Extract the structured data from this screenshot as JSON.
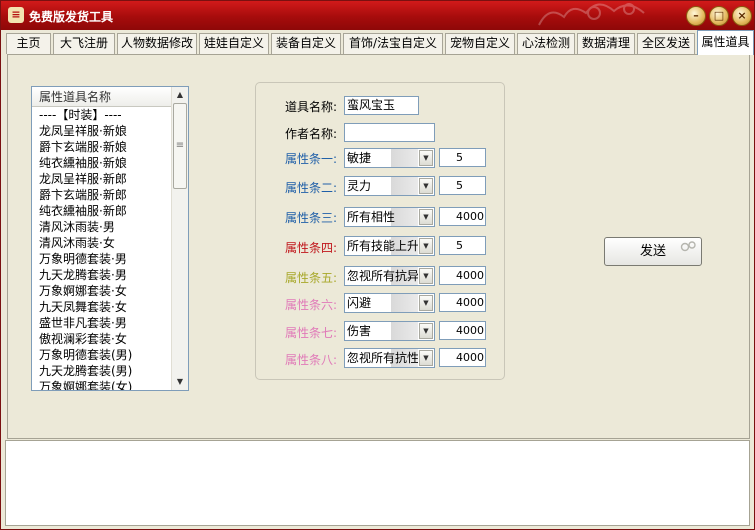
{
  "window": {
    "title": "免费版发货工具",
    "icon": "app-badge-icon",
    "controls": [
      "minimize-icon",
      "maximize-icon",
      "close-icon"
    ]
  },
  "tabs": [
    {
      "label": "主页"
    },
    {
      "label": "大飞注册"
    },
    {
      "label": "人物数据修改"
    },
    {
      "label": "娃娃自定义"
    },
    {
      "label": "装备自定义"
    },
    {
      "label": "首饰/法宝自定义"
    },
    {
      "label": "宠物自定义"
    },
    {
      "label": "心法检测"
    },
    {
      "label": "数据清理"
    },
    {
      "label": "全区发送"
    },
    {
      "label": "属性道具",
      "active": true
    }
  ],
  "item_list": {
    "header": "属性道具名称",
    "items": [
      "----【时装】----",
      "龙凤呈祥服·新娘",
      "爵卞玄端服·新娘",
      "纯衣纁袖服·新娘",
      "龙凤呈祥服·新郎",
      "爵卞玄端服·新郎",
      "纯衣纁袖服·新郎",
      "清风沐雨装·男",
      "清风沐雨装·女",
      "万象明德套装·男",
      "九天龙腾套装·男",
      "万象婀娜套装·女",
      "九天凤舞套装·女",
      "盛世非凡套装·男",
      "傲视澜彩套装·女",
      "万象明德套装(男)",
      "九天龙腾套装(男)",
      "万象婀娜套装(女)"
    ]
  },
  "form": {
    "item_name_label": "道具名称:",
    "item_name_value": "蛮风宝玉",
    "author_label": "作者名称:",
    "author_value": "",
    "attributes": [
      {
        "label": "属性条一:",
        "value": "敏捷",
        "amount": "5",
        "color": "#1f5fa8"
      },
      {
        "label": "属性条二:",
        "value": "灵力",
        "amount": "5",
        "color": "#1f5fa8"
      },
      {
        "label": "属性条三:",
        "value": "所有相性",
        "amount": "4000",
        "color": "#1f5fa8"
      },
      {
        "label": "属性条四:",
        "value": "所有技能上升",
        "amount": "5",
        "color": "#c0161b"
      },
      {
        "label": "属性条五:",
        "value": "忽视所有抗异常",
        "amount": "4000",
        "color": "#a8a82a"
      },
      {
        "label": "属性条六:",
        "value": "闪避",
        "amount": "4000",
        "color": "#e07ab8"
      },
      {
        "label": "属性条七:",
        "value": "伤害",
        "amount": "4000",
        "color": "#e07ab8"
      },
      {
        "label": "属性条八:",
        "value": "忽视所有抗性",
        "amount": "4000",
        "color": "#e07ab8"
      }
    ]
  },
  "send_button": {
    "label": "发送"
  }
}
